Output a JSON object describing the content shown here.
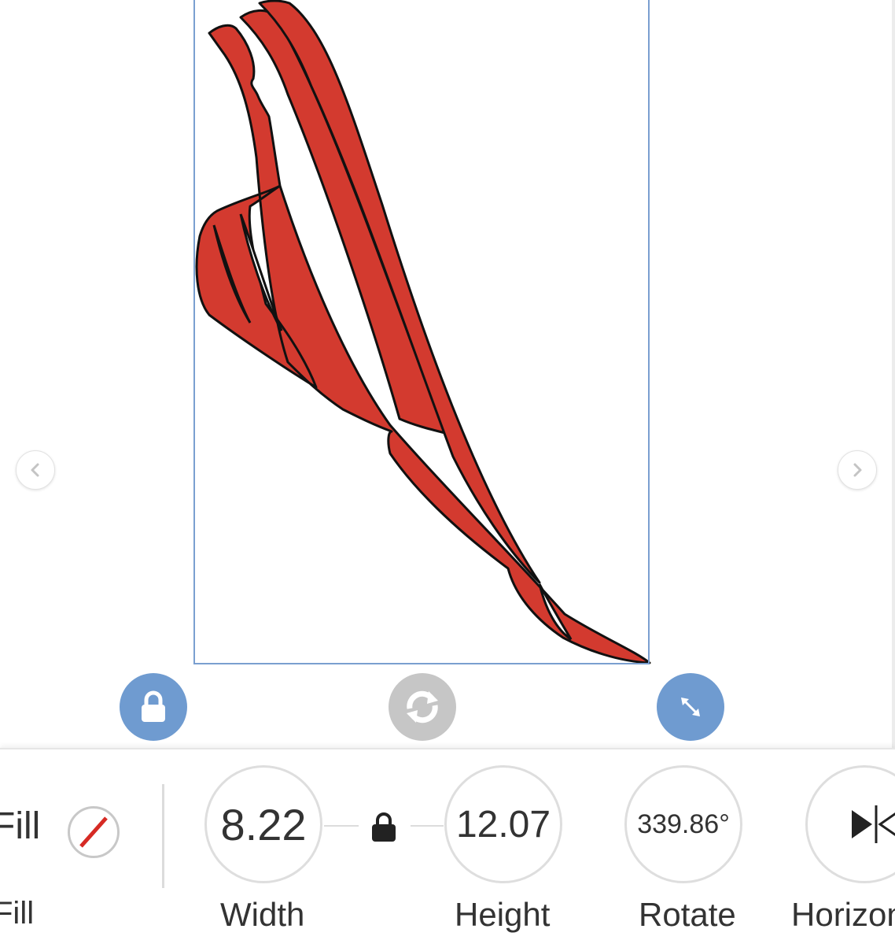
{
  "canvas": {
    "shape_fill": "#d33a2f",
    "shape_stroke": "#111111",
    "selection_color": "#7a9fd0",
    "handle_color": "#6f9bd0",
    "rotate_handle_color": "#c6c6c6",
    "handles": {
      "lock_icon": "lock-icon",
      "rotate_icon": "rotate-arrows-icon",
      "resize_icon": "resize-arrows-icon"
    },
    "nav": {
      "prev_icon": "chevron-left-icon",
      "next_icon": "chevron-right-icon"
    }
  },
  "panel": {
    "fill": {
      "label_top": "Fill",
      "label": "Fill",
      "swatch": "none"
    },
    "width": {
      "value": "8.22",
      "label": "Width"
    },
    "height": {
      "value": "12.07",
      "label": "Height"
    },
    "ratio_lock_icon": "lock-icon",
    "rotate": {
      "value": "339.86°",
      "label": "Rotate"
    },
    "flip": {
      "icon": "flip-horizontal-icon",
      "label": "Horizon"
    }
  }
}
